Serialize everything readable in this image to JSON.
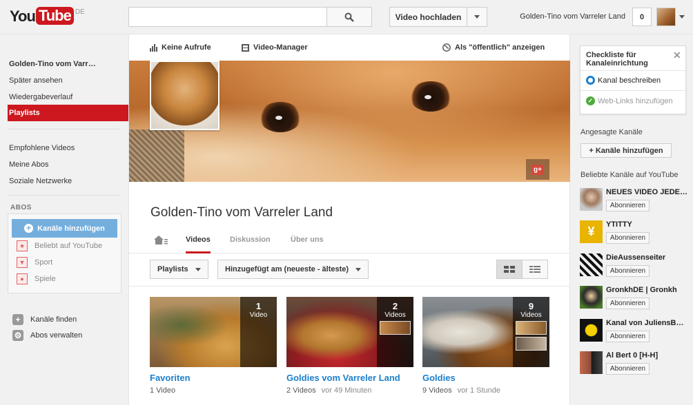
{
  "header": {
    "logo_you": "You",
    "logo_tube": "Tube",
    "region": "DE",
    "search_placeholder": "",
    "upload_label": "Video hochladen",
    "user_name": "Golden-Tino vom Varreler Land",
    "notification_count": "0"
  },
  "guide": {
    "channel_name": "Golden-Tino vom Varr…",
    "watch_later": "Später ansehen",
    "history": "Wiedergabeverlauf",
    "playlists": "Playlists",
    "recommended": "Empfohlene Videos",
    "my_subs": "Meine Abos",
    "social": "Soziale Netzwerke",
    "abos_heading": "ABOS",
    "add_channels": "Kanäle hinzufügen",
    "abos_items": [
      "Beliebt auf YouTube",
      "Sport",
      "Spiele"
    ],
    "find_channels": "Kanäle finden",
    "manage_subs": "Abos verwalten"
  },
  "main": {
    "topbar": {
      "views": "Keine Aufrufe",
      "video_manager": "Video-Manager",
      "view_as_public": "Als \"öffentlich\" anzeigen"
    },
    "channel_title": "Golden-Tino vom Varreler Land",
    "tabs": [
      "Videos",
      "Diskussion",
      "Über uns"
    ],
    "playlists_dropdown": "Playlists",
    "sort_dropdown": "Hinzugefügt am (neueste - älteste)",
    "playlists": [
      {
        "count": "1",
        "count_label": "Video",
        "title": "Favoriten",
        "meta": "1 Video",
        "ago": ""
      },
      {
        "count": "2",
        "count_label": "Videos",
        "title": "Goldies vom Varreler Land",
        "meta": "2 Videos",
        "ago": "vor 49 Minuten"
      },
      {
        "count": "9",
        "count_label": "Videos",
        "title": "Goldies",
        "meta": "9 Videos",
        "ago": "vor 1 Stunde"
      }
    ]
  },
  "right": {
    "checklist_title": "Checkliste für Kanaleinrichtung",
    "checklist_items": [
      "Kanal beschreiben",
      "Web-Links hinzufügen"
    ],
    "featured_label": "Angesagte Kanäle",
    "add_channels_btn": "+ Kanäle hinzufügen",
    "popular_label": "Beliebte Kanäle auf YouTube",
    "subscribe_label": "Abonnieren",
    "channels": [
      {
        "name": "NEUES VIDEO JEDEN…"
      },
      {
        "name": "YTITTY"
      },
      {
        "name": "DieAussenseiter"
      },
      {
        "name": "GronkhDE | Gronkh"
      },
      {
        "name": "Kanal von JuliensB…"
      },
      {
        "name": "Al Bert 0 [H-H]"
      }
    ]
  },
  "colors": {
    "brand_red": "#cc181e",
    "link_blue": "#1b7fcc",
    "guide_button_blue": "#74aedd"
  }
}
